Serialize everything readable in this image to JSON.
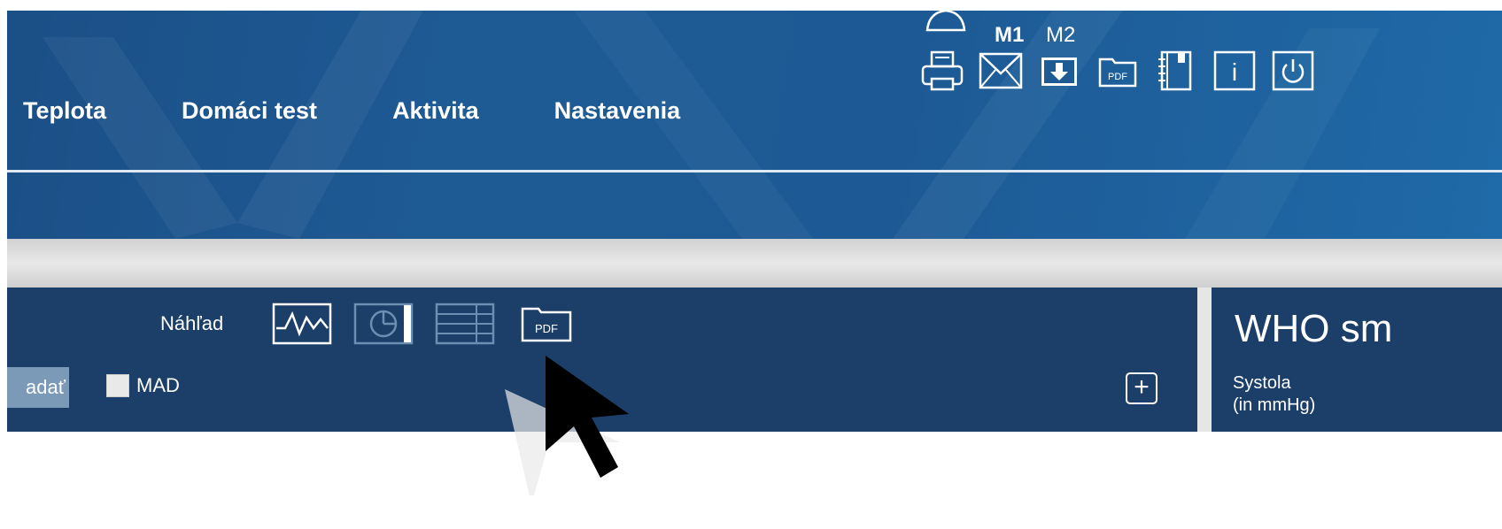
{
  "header": {
    "memory_selector": {
      "m1": "M1",
      "m2": "M2"
    },
    "toolbar": [
      {
        "name": "print-button",
        "icon": "printer-icon"
      },
      {
        "name": "email-button",
        "icon": "envelope-icon"
      },
      {
        "name": "download-button",
        "icon": "download-icon"
      },
      {
        "name": "pdf-export-button",
        "icon": "pdf-icon",
        "label": "PDF"
      },
      {
        "name": "notebook-button",
        "icon": "notebook-icon"
      },
      {
        "name": "info-button",
        "icon": "info-icon",
        "label": "i"
      },
      {
        "name": "power-button",
        "icon": "power-icon"
      }
    ]
  },
  "nav": [
    {
      "label": "Teplota"
    },
    {
      "label": "Domáci test"
    },
    {
      "label": "Aktivita"
    },
    {
      "label": "Nastavenia"
    }
  ],
  "panel": {
    "preview_label": "Náhľad",
    "preview_views": [
      {
        "icon": "line-chart-icon"
      },
      {
        "icon": "pie-chart-icon"
      },
      {
        "icon": "table-icon"
      },
      {
        "icon": "pdf-icon",
        "label": "PDF"
      }
    ],
    "search_button": "adať",
    "mad_label": "MAD",
    "add_symbol": "+"
  },
  "who_panel": {
    "title": "WHO sm",
    "systola_label": "Systola",
    "systola_unit": "(in mmHg)"
  },
  "colors": {
    "header_blue": "#1e5a94",
    "panel_navy": "#1b3f68"
  }
}
